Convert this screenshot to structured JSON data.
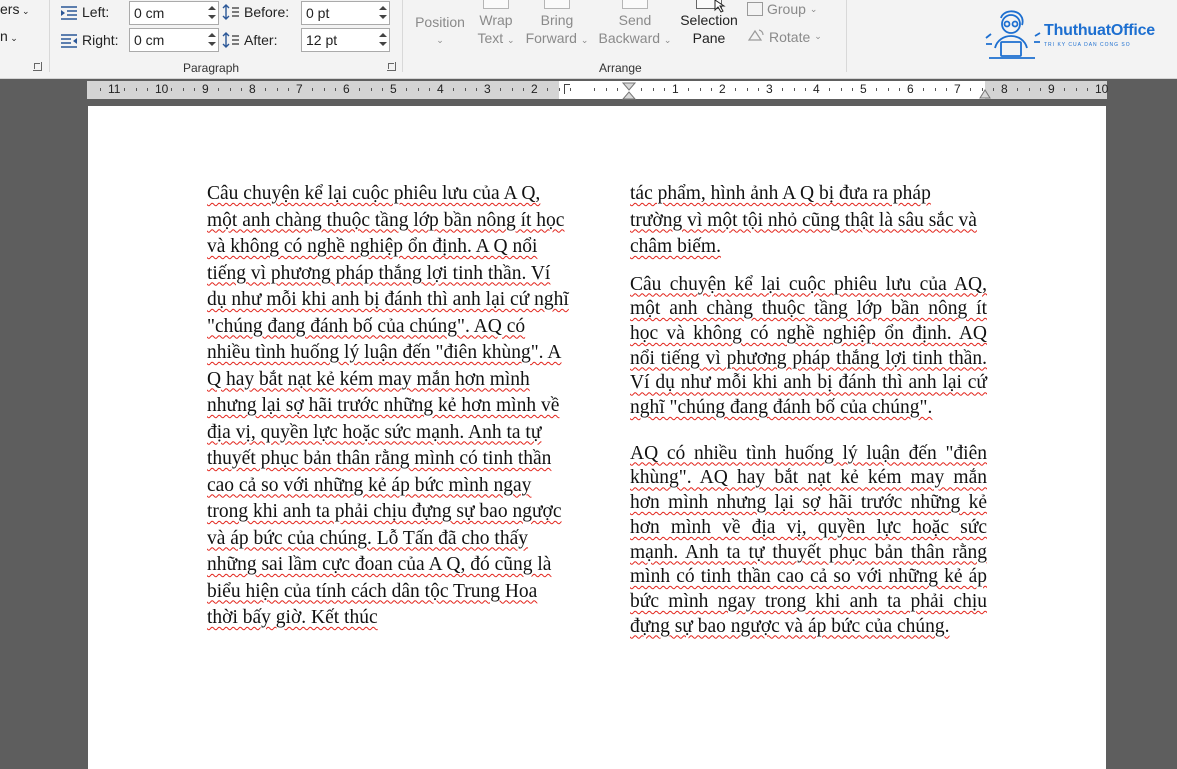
{
  "ribbon": {
    "cut_left_top": "ers",
    "cut_left_bottom": "n",
    "paragraph": {
      "group_label": "Paragraph",
      "left_label": "Left:",
      "left_value": "0 cm",
      "right_label": "Right:",
      "right_value": "0 cm",
      "before_label": "Before:",
      "before_value": "0 pt",
      "after_label": "After:",
      "after_value": "12 pt"
    },
    "arrange": {
      "group_label": "Arrange",
      "position_label": "Position",
      "wrap_line1": "Wrap",
      "wrap_line2": "Text",
      "bring_line1": "Bring",
      "bring_line2": "Forward",
      "send_line1": "Send",
      "send_line2": "Backward",
      "selection_line1": "Selection",
      "selection_line2": "Pane",
      "group_btn": "Group",
      "rotate_btn": "Rotate"
    },
    "logo": {
      "title": "ThuthuatOffice",
      "subtitle": "TRI KY CUA DAN CONG SO"
    }
  },
  "ruler": {
    "labels_left": [
      "11",
      "10",
      "9",
      "8",
      "7",
      "6",
      "5",
      "4",
      "3",
      "2"
    ],
    "labels_right": [
      "1",
      "2",
      "3",
      "4",
      "5",
      "6",
      "7",
      "8",
      "9",
      "10"
    ]
  },
  "document": {
    "col1_text": "Câu chuyện kể lại cuộc phiêu lưu của A Q, một anh chàng thuộc tầng lớp bần nông ít học và không có nghề nghiệp ổn định. A Q nổi tiếng vì phương pháp thắng lợi tinh thần. Ví dụ như mỗi khi anh bị đánh thì anh lại cứ nghĩ \"chúng đang đánh bố của chúng\". AQ có nhiều tình huống lý luận đến \"điên khùng\". A Q hay bắt nạt kẻ kém may mắn hơn mình nhưng lại sợ hãi trước những kẻ hơn mình về địa vị, quyền lực hoặc sức mạnh. Anh ta tự thuyết phục bản thân rằng mình có tinh thần cao cả so với những kẻ áp bức mình ngay trong khi anh ta phải chịu đựng sự bao ngược và áp bức của chúng. Lỗ Tấn đã cho thấy những sai lầm cực đoan của A Q, đó cũng là biểu hiện của tính cách dân tộc Trung Hoa thời bấy giờ. Kết thúc",
    "col2_p1": "tác phẩm, hình ảnh A Q bị đưa ra pháp trường vì một tội nhỏ cũng thật là sâu sắc và châm biếm.",
    "col2_p2": "Câu chuyện kể lại cuộc phiêu lưu của AQ, một anh chàng thuộc tầng lớp bần nông ít học và không có nghề nghiệp ổn định. AQ nổi tiếng vì phương pháp thắng lợi tinh thần. Ví dụ như mỗi khi anh bị đánh thì anh lại cứ nghĩ \"chúng đang đánh bố của chúng\".",
    "col2_p3": "AQ có nhiều tình huống lý luận đến \"điên khùng\". AQ hay bắt nạt kẻ kém may mắn hơn mình nhưng lại sợ hãi trước những kẻ hơn mình về địa vị, quyền lực hoặc sức mạnh. Anh ta tự thuyết phục bản thân rằng mình có tinh thần cao cả so với những kẻ áp bức mình ngay trong khi anh ta phải chịu đựng sự bao ngược và áp bức của chúng."
  }
}
